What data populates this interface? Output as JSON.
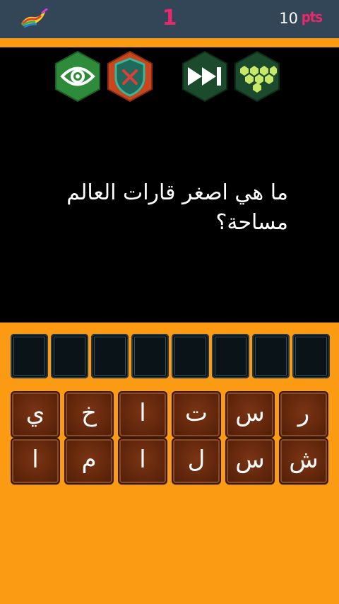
{
  "header": {
    "logo_icon": "rainbow-brush-logo",
    "level": "1",
    "score": "10",
    "score_unit": "pts"
  },
  "hints": [
    {
      "name": "reveal-letter",
      "icon": "eye-icon",
      "color": "#2e8b3a"
    },
    {
      "name": "remove-letters",
      "icon": "shield-x-icon",
      "color": "#c8461e"
    },
    {
      "name": "skip-question",
      "icon": "fast-forward-icon",
      "color": "#1c4a2c"
    },
    {
      "name": "share",
      "icon": "pyramid-dots-icon",
      "color": "#1c4a2c"
    }
  ],
  "question": {
    "line1": "ما هي اصغر قارات العالم",
    "line2": "مساحة؟"
  },
  "answer_slots_count": 8,
  "letter_keys": {
    "row1": [
      "ي",
      "خ",
      "ا",
      "ت",
      "س",
      "ر"
    ],
    "row2": [
      "ا",
      "م",
      "ا",
      "ل",
      "س",
      "ش"
    ]
  },
  "colors": {
    "top_bar": "#334657",
    "accent_pink": "#e8286a",
    "background_orange": "#fb9b14",
    "key_brown": "#61260c"
  }
}
